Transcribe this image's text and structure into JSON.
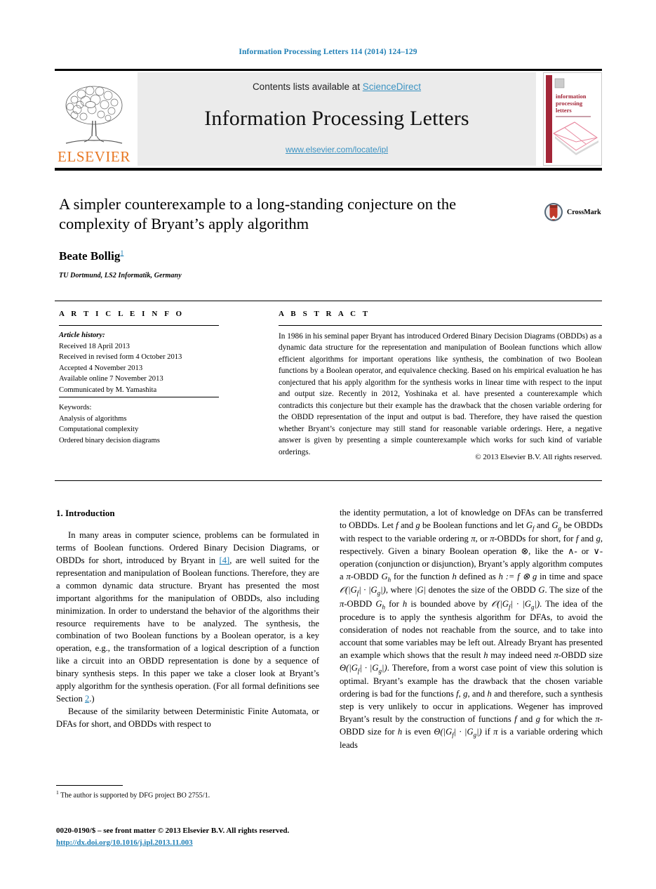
{
  "running_head": "Information Processing Letters 114 (2014) 124–129",
  "masthead": {
    "contents_prefix": "Contents lists available at ",
    "sciencedirect": "ScienceDirect",
    "journal_title": "Information Processing Letters",
    "journal_url": "www.elsevier.com/locate/ipl",
    "publisher_wordmark": "ELSEVIER",
    "cover_title_lines": [
      "information",
      "processing",
      "letters"
    ],
    "colors": {
      "link": "#3c93c2",
      "elsevier_orange": "#e87722",
      "cover_spine": "#a32638",
      "running_head": "#1f7fb5"
    }
  },
  "article": {
    "title": "A simpler counterexample to a long-standing conjecture on the complexity of Bryant’s apply algorithm",
    "author": "Beate Bollig",
    "author_footnote_marker": "1",
    "affiliation": "TU Dortmund, LS2 Informatik, Germany",
    "crossmark_label": "CrossMark"
  },
  "info": {
    "heading": "A R T I C L E   I N F O",
    "history_label": "Article history:",
    "history": [
      "Received 18 April 2013",
      "Received in revised form 4 October 2013",
      "Accepted 4 November 2013",
      "Available online 7 November 2013",
      "Communicated by M. Yamashita"
    ],
    "keywords_label": "Keywords:",
    "keywords": [
      "Analysis of algorithms",
      "Computational complexity",
      "Ordered binary decision diagrams"
    ]
  },
  "abstract": {
    "heading": "A B S T R A C T",
    "text": "In 1986 in his seminal paper Bryant has introduced Ordered Binary Decision Diagrams (OBDDs) as a dynamic data structure for the representation and manipulation of Boolean functions which allow efficient algorithms for important operations like synthesis, the combination of two Boolean functions by a Boolean operator, and equivalence checking. Based on his empirical evaluation he has conjectured that his apply algorithm for the synthesis works in linear time with respect to the input and output size. Recently in 2012, Yoshinaka et al. have presented a counterexample which contradicts this conjecture but their example has the drawback that the chosen variable ordering for the OBDD representation of the input and output is bad. Therefore, they have raised the question whether Bryant’s conjecture may still stand for reasonable variable orderings. Here, a negative answer is given by presenting a simple counterexample which works for such kind of variable orderings.",
    "copyright": "© 2013 Elsevier B.V. All rights reserved."
  },
  "body": {
    "section_number_title": "1. Introduction",
    "left_p1_a": "In many areas in computer science, problems can be formulated in terms of Boolean functions. Ordered Binary Decision Diagrams, or OBDDs for short, introduced by Bryant in ",
    "left_ref_4": "[4]",
    "left_p1_b": ", are well suited for the representation and manipulation of Boolean functions. Therefore, they are a common dynamic data structure. Bryant has presented the most important algorithms for the manipulation of OBDDs, also including minimization. In order to understand the behavior of the algorithms their resource requirements have to be analyzed. The synthesis, the combination of two Boolean functions by a Boolean operator, is a key operation, e.g., the transformation of a logical description of a function like a circuit into an OBDD representation is done by a sequence of binary synthesis steps. In this paper we take a closer look at Bryant’s apply algorithm for the synthesis operation. (For all formal definitions see Section ",
    "left_ref_2": "2",
    "left_p1_c": ".)",
    "left_p2": "Because of the similarity between Deterministic Finite Automata, or DFAs for short, and OBDDs with respect to",
    "right_p1_parts": [
      "the identity permutation, a lot of knowledge on DFAs can be transferred to OBDDs. Let ",
      " and ",
      " be Boolean functions and let ",
      " and ",
      " be OBDDs with respect to the variable ordering ",
      ", or ",
      "-OBDDs for short, for ",
      " and ",
      ", respectively. Given a binary Boolean operation ",
      ", like the ",
      "- or ",
      "-operation (conjunction or disjunction), Bryant’s apply algorithm computes a ",
      "-OBDD ",
      " for the function ",
      " defined as ",
      " in time and space ",
      ", where ",
      " denotes the size of the OBDD ",
      ". The size of the ",
      "-OBDD ",
      " for ",
      " is bounded above by ",
      ". The idea of the procedure is to apply the synthesis algorithm for DFAs, to avoid the consideration of nodes not reachable from the source, and to take into account that some variables may be left out. Already Bryant has presented an example which shows that the result ",
      " may indeed need ",
      "-OBDD size ",
      ". Therefore, from a worst case point of view this solution is optimal. Bryant’s example has the drawback that the chosen variable ordering is bad for the functions ",
      ", ",
      ", and ",
      " and therefore, such a synthesis step is very unlikely to occur in applications. Wegener has improved Bryant’s result by the construction of functions ",
      " and ",
      " for which the ",
      "-OBDD size for ",
      " is even ",
      " if ",
      " is a variable ordering which leads"
    ],
    "math": {
      "f": "f",
      "g": "g",
      "h": "h",
      "G": "G",
      "G_f": "G_f",
      "G_g": "G_g",
      "G_h": "G_h",
      "pi": "π",
      "otimes": "⊗",
      "wedge": "∧",
      "vee": "∨",
      "abs_G": "|G|",
      "big_O": "𝒪(|G_f| · |G_g|)",
      "theta": "Θ(|G_f| · |G_g|)",
      "h_def": "h := f ⊗ g"
    }
  },
  "footer": {
    "footnote_marker": "1",
    "footnote_text": "The author is supported by DFG project BO 2755/1.",
    "issn_line": "0020-0190/$ – see front matter © 2013 Elsevier B.V. All rights reserved.",
    "doi": "http://dx.doi.org/10.1016/j.ipl.2013.11.003"
  }
}
